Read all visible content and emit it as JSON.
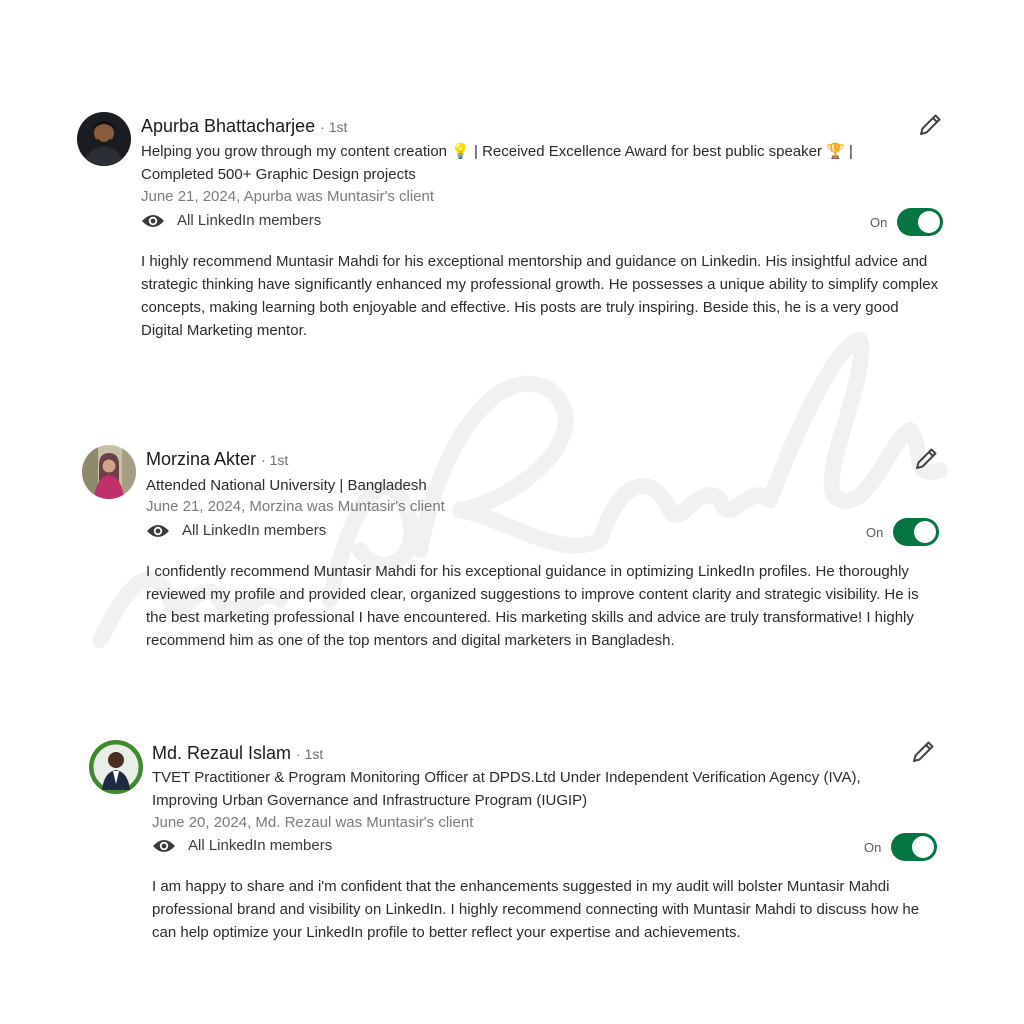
{
  "recommendations": [
    {
      "name": "Apurba Bhattacharjee",
      "degree": "· 1st",
      "headline": "Helping you grow through my content creation 💡 | Received Excellence Award for best public speaker 🏆 | Completed 500+ Graphic Design projects",
      "meta": "June 21, 2024, Apurba was Muntasir's client",
      "visibility": "All LinkedIn members",
      "toggle_label": "On",
      "text": "I highly recommend Muntasir Mahdi for his exceptional mentorship and guidance on Linkedin. His insightful advice and strategic thinking have significantly enhanced my professional growth. He possesses a unique ability to simplify complex concepts, making learning both enjoyable and effective. His posts are truly inspiring. Beside this, he is a very good Digital Marketing mentor."
    },
    {
      "name": "Morzina Akter",
      "degree": "· 1st",
      "headline": "Attended National University | Bangladesh",
      "meta": "June 21, 2024, Morzina was Muntasir's client",
      "visibility": "All LinkedIn members",
      "toggle_label": "On",
      "text": "I confidently recommend Muntasir Mahdi for his exceptional guidance in optimizing LinkedIn profiles. He thoroughly reviewed my profile and provided clear, organized suggestions to improve content clarity and strategic visibility. He is the best marketing professional I have encountered. His marketing skills and advice are truly transformative! I highly recommend him as one of the top mentors and digital marketers in Bangladesh."
    },
    {
      "name": "Md. Rezaul Islam",
      "degree": "· 1st",
      "headline": "TVET Practitioner & Program Monitoring Officer at DPDS.Ltd Under Independent Verification Agency (IVA), Improving Urban Governance and Infrastructure Program (IUGIP)",
      "meta": "June 20, 2024, Md. Rezaul was Muntasir's client",
      "visibility": "All LinkedIn members",
      "toggle_label": "On",
      "text": "I am happy to share and i'm confident that the enhancements suggested in my audit will bolster Muntasir Mahdi professional brand and visibility on LinkedIn. I highly recommend connecting with Muntasir Mahdi to discuss how he can help optimize your LinkedIn profile to better reflect your expertise and achievements."
    }
  ],
  "watermark_text": "Muntasir Mahdi",
  "colors": {
    "toggle_on": "#057642",
    "meta_text": "#7a7a7a"
  },
  "icons": [
    "eye-icon",
    "pencil-icon",
    "avatar"
  ]
}
